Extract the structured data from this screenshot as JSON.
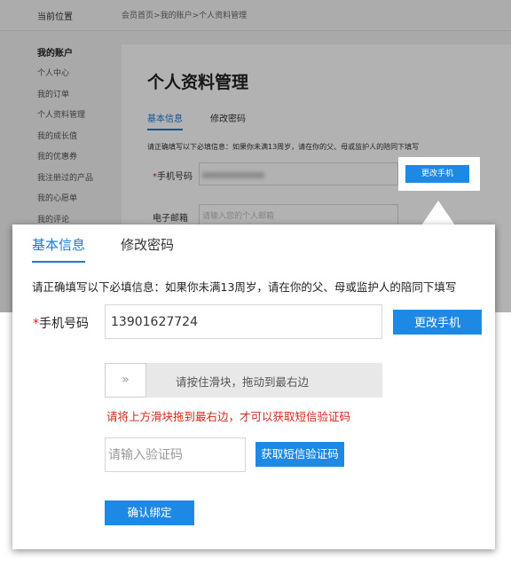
{
  "breadcrumb": {
    "label": "当前位置",
    "items": [
      "会员首页",
      ">",
      "我的账户",
      ">",
      "个人资料管理"
    ]
  },
  "sidebar": {
    "title": "我的账户",
    "items": [
      "个人中心",
      "我的订单",
      "个人资料管理",
      "我的成长值",
      "我的优惠券",
      "我注册过的产品",
      "我的心愿单",
      "我的评论"
    ]
  },
  "background_form": {
    "page_title": "个人资料管理",
    "tabs": [
      "基本信息",
      "修改密码"
    ],
    "note": "请正确填写以下必填信息：如果你未满13周岁，请在你的父、母或监护人的陪同下填写",
    "phone_star": "*",
    "phone_label": "手机号码",
    "email_label": "电子邮箱",
    "email_placeholder": "请输入您的个人邮箱",
    "change_phone_label": "更改手机"
  },
  "panel": {
    "tabs": [
      "基本信息",
      "修改密码"
    ],
    "note": "请正确填写以下必填信息：如果你未满13周岁，请在你的父、母或监护人的陪同下填写",
    "phone_star": "*",
    "phone_label": "手机号码",
    "phone_value": "13901627724",
    "change_phone_label": "更改手机",
    "slider_handle": "»",
    "slider_text": "请按住滑块，拖动到最右边",
    "slider_error": "请将上方滑块拖到最右边，才可以获取短信验证码",
    "code_placeholder": "请输入验证码",
    "sms_button": "获取短信验证码",
    "confirm_button": "确认绑定"
  },
  "colors": {
    "accent": "#1e88e5",
    "error": "#d9251c",
    "required_star": "#e02020"
  }
}
